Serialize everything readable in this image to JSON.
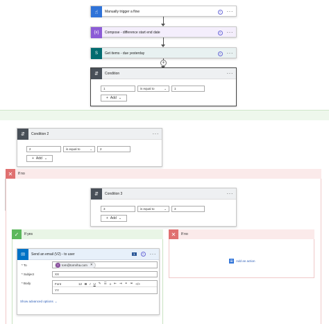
{
  "flow": {
    "trigger": {
      "title": "Manually trigger a flow",
      "color": "#2f73d8",
      "icon": "hand-pointer-icon"
    },
    "compose": {
      "title": "Compose - difference start end date",
      "color": "#8c5cd6",
      "icon": "braces-icon"
    },
    "get_items": {
      "title": "Get items - due yesterday",
      "color": "#036c70",
      "icon": "sharepoint-icon"
    },
    "condition1": {
      "title": "Condition",
      "left": "1",
      "operator": "is equal to",
      "right": "1",
      "add_label": "Add"
    },
    "condition2": {
      "title": "Condition 2",
      "left": "2",
      "operator": "is equal to",
      "right": "2",
      "add_label": "Add"
    },
    "if_no_outer": {
      "label": "If no"
    },
    "condition3": {
      "title": "Condition 3",
      "left": "3",
      "operator": "is equal to",
      "right": "3",
      "add_label": "Add"
    },
    "if_yes": {
      "label": "If yes"
    },
    "if_no_inner": {
      "label": "If no",
      "add_action": "Add an action"
    },
    "email": {
      "title": "Send an email (V2) - to user",
      "badge": "1",
      "to_label": "* To",
      "to_chip_initial": "T",
      "to_chip_text": "tom@tomriha.com",
      "subject_label": "* Subject",
      "subject_value": "XX",
      "body_label": "* Body",
      "font_label": "Font",
      "font_size": "12",
      "body_value": "YY",
      "advanced": "Show advanced options"
    }
  },
  "colors": {
    "condition_tile": "#484f58",
    "yes_green": "#5cb85c",
    "no_red": "#e07070",
    "yes_bg": "#e9f5e6",
    "no_bg": "#fbeaea",
    "outlook_blue": "#0072c6",
    "accent": "#5b5fc7"
  }
}
